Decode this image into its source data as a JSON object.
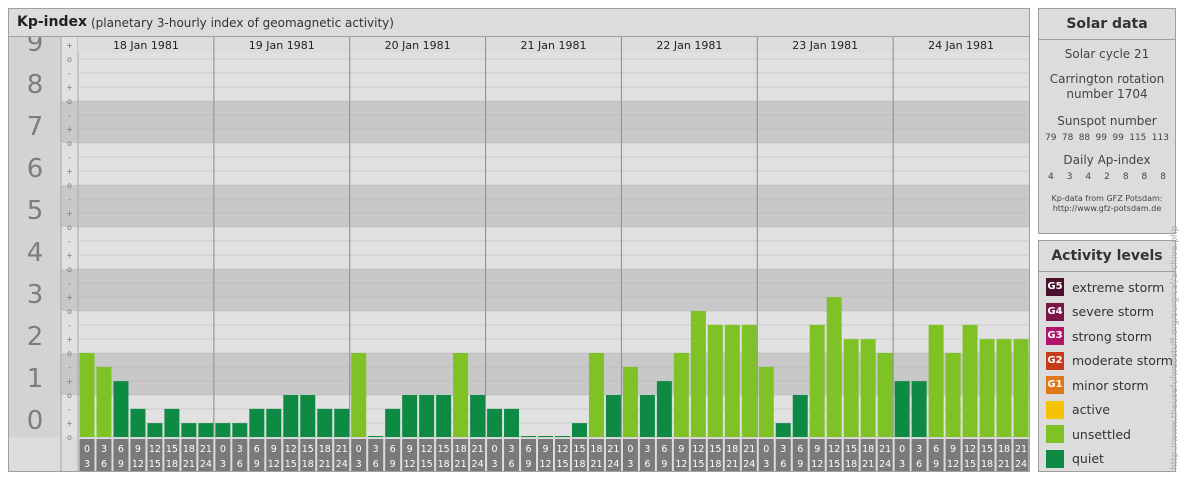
{
  "header": {
    "title": "Kp-index",
    "subtitle": "(planetary 3-hourly index of geomagnetic activity)"
  },
  "chart_data": {
    "type": "bar",
    "title": "Kp-index",
    "subtitle": "(planetary 3-hourly index of geomagnetic activity)",
    "ylim": [
      0,
      9.33
    ],
    "y_major_ticks": [
      "0",
      "1",
      "2",
      "3",
      "4",
      "5",
      "6",
      "7",
      "8",
      "9"
    ],
    "y_minor_ticks": [
      "o",
      "+",
      "-"
    ],
    "days": [
      "18 Jan 1981",
      "19 Jan 1981",
      "20 Jan 1981",
      "21 Jan 1981",
      "22 Jan 1981",
      "23 Jan 1981",
      "24 Jan 1981"
    ],
    "interval_start_labels": [
      "0",
      "3",
      "6",
      "9",
      "12",
      "15",
      "18",
      "21"
    ],
    "interval_end_labels": [
      "3",
      "6",
      "9",
      "12",
      "15",
      "18",
      "21",
      "24"
    ],
    "values": [
      [
        2.0,
        1.67,
        1.33,
        0.67,
        0.33,
        0.67,
        0.33,
        0.33
      ],
      [
        0.33,
        0.33,
        0.67,
        0.67,
        1.0,
        1.0,
        0.67,
        0.67
      ],
      [
        2.0,
        0.0,
        0.67,
        1.0,
        1.0,
        1.0,
        2.0,
        1.0
      ],
      [
        0.67,
        0.67,
        0.0,
        0.0,
        0.0,
        0.33,
        2.0,
        1.0
      ],
      [
        1.67,
        1.0,
        1.33,
        2.0,
        3.0,
        2.67,
        2.67,
        2.67
      ],
      [
        1.67,
        0.33,
        1.0,
        2.67,
        3.33,
        2.33,
        2.33,
        2.0
      ],
      [
        1.33,
        1.33,
        2.67,
        2.0,
        2.67,
        2.33,
        2.33,
        2.33
      ]
    ],
    "grid": true,
    "legend_position": "right"
  },
  "solar": {
    "title": "Solar data",
    "cycle": "Solar cycle 21",
    "carrington": "Carrington rotation number 1704",
    "sunspot_title": "Sunspot number",
    "sunspot_values": [
      "79",
      "78",
      "88",
      "99",
      "99",
      "115",
      "113"
    ],
    "ap_title": "Daily Ap-index",
    "ap_values": [
      "4",
      "3",
      "4",
      "2",
      "8",
      "8",
      "8"
    ],
    "credit_line1": "Kp-data from GFZ Potsdam:",
    "credit_line2": "http://www.gfz-potsdam.de"
  },
  "activity": {
    "title": "Activity levels",
    "items": [
      {
        "code": "G5",
        "label": "extreme storm",
        "color": "#4a0f2a"
      },
      {
        "code": "G4",
        "label": "severe storm",
        "color": "#7a1548"
      },
      {
        "code": "G3",
        "label": "strong storm",
        "color": "#b0146b"
      },
      {
        "code": "G2",
        "label": "moderate storm",
        "color": "#c83a1a"
      },
      {
        "code": "G1",
        "label": "minor storm",
        "color": "#e07818"
      },
      {
        "code": "",
        "label": "active",
        "color": "#f5c400"
      },
      {
        "code": "",
        "label": "unsettled",
        "color": "#7ec225"
      },
      {
        "code": "",
        "label": "quiet",
        "color": "#0e8a45"
      }
    ]
  },
  "colors": {
    "quiet": "#0e8a45",
    "unsettled": "#7ec225",
    "band_dark": "#c8c8c8",
    "band_light": "#e1e1e1"
  },
  "watermark": "http://www.theusefulwebstuff.org/surgical/archive.php"
}
